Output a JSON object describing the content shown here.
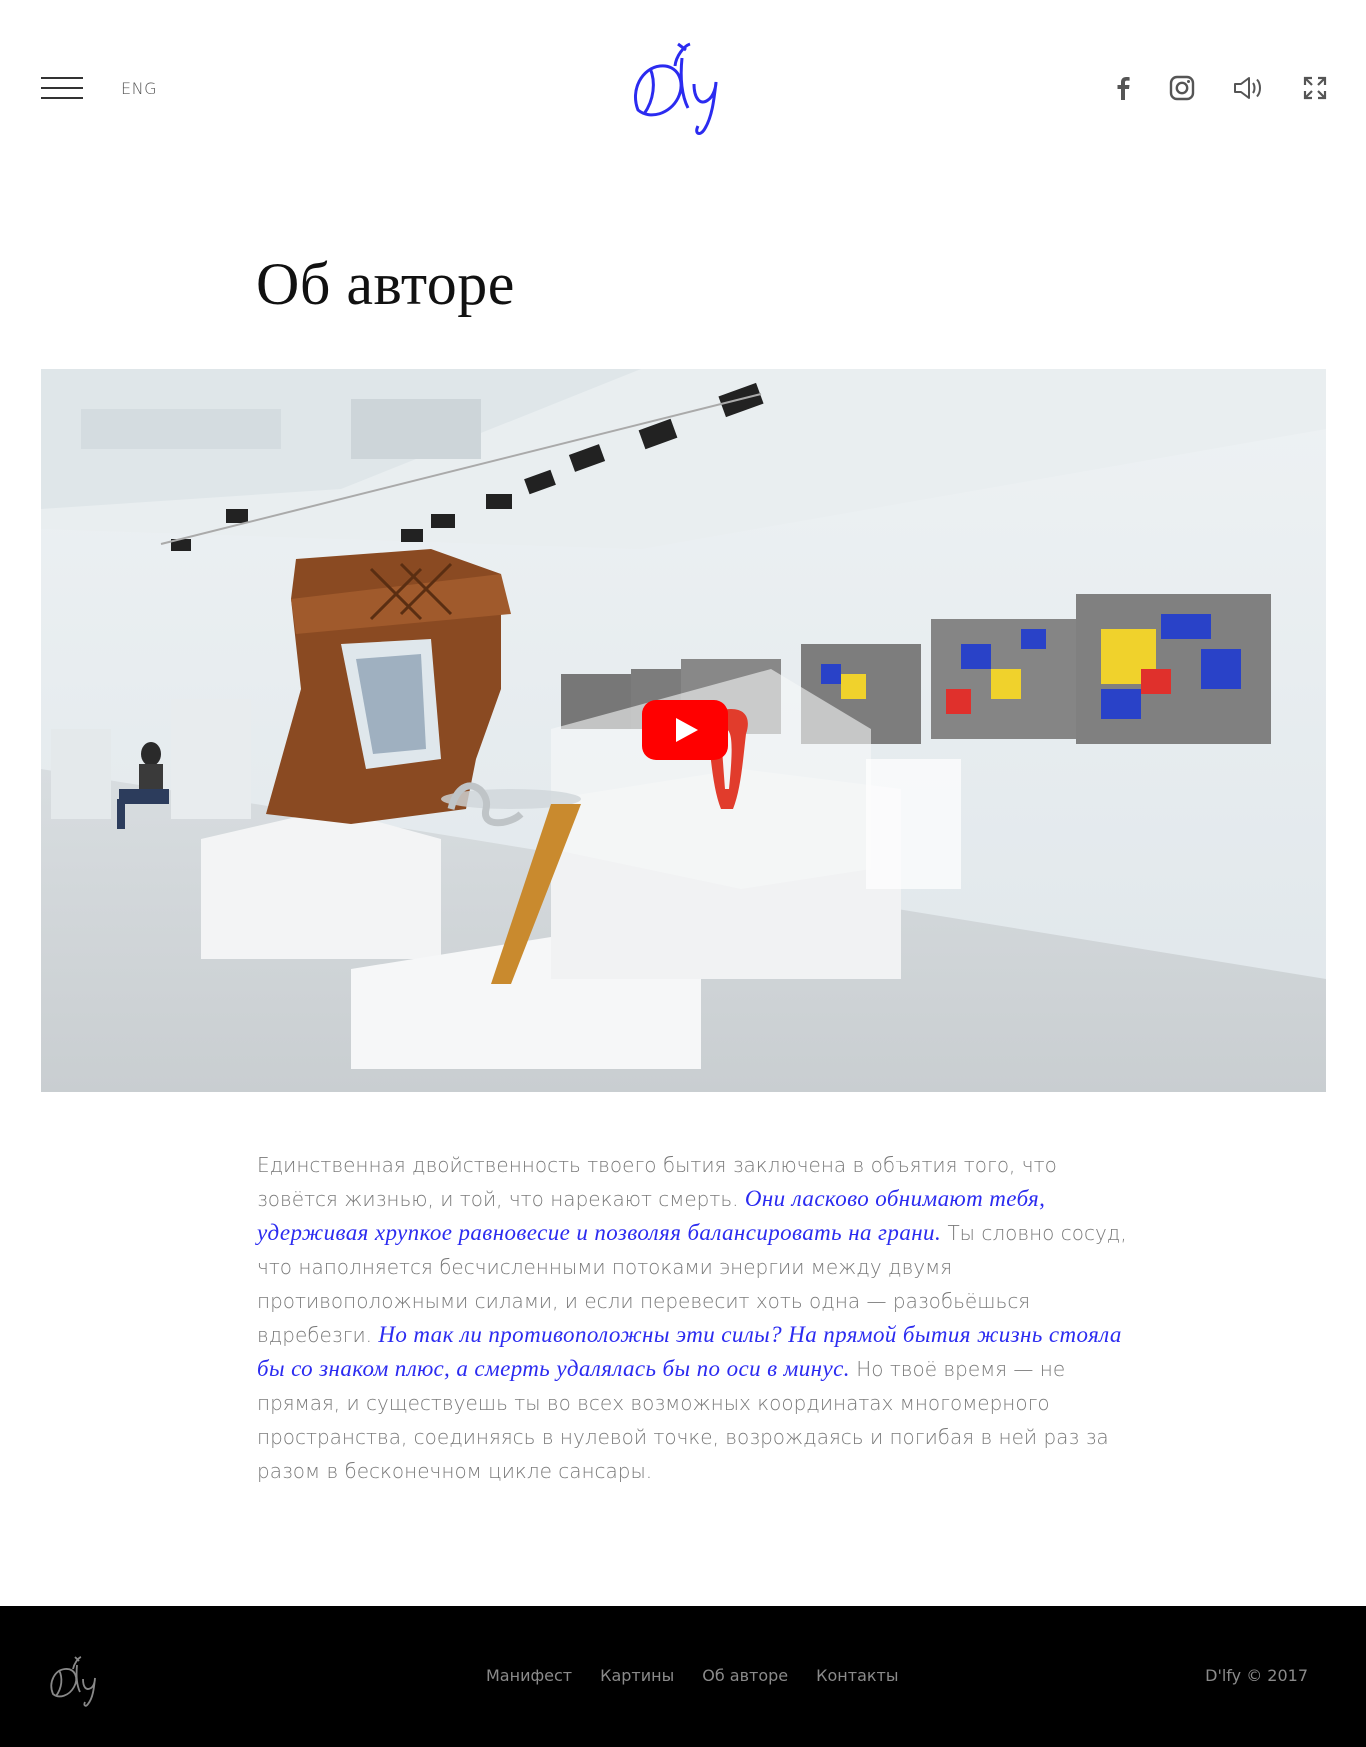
{
  "header": {
    "lang": "ENG",
    "logo_text": "D'lfy",
    "social": [
      "facebook-icon",
      "instagram-icon",
      "sound-icon",
      "fullscreen-icon"
    ]
  },
  "title": "Об авторе",
  "video": {
    "play_icon": "youtube-play-icon"
  },
  "body": {
    "p1": "Единственная двойственность твоего бытия заключена в объятия того, что зовётся жизнью, и той, что нарекают смерть. ",
    "a1": "Они ласково обнимают тебя, удерживая хрупкое равновесие и позволяя балансировать на грани.",
    "p2": " Ты словно сосуд, что наполняется бесчисленными потоками энергии между двумя противоположными силами, и если перевесит хоть одна — разобьёшься вдребезги. ",
    "a2": "Но так ли противоположны эти силы? На прямой бытия жизнь стояла бы со знаком плюс, а смерть удалялась бы по оси в минус.",
    "p3": " Но твоё время — не прямая, и существуешь ты во всех возможных координатах многомерного пространства, соединяясь в нулевой точке, возрождаясь и погибая в ней раз за разом в бесконечном цикле сансары."
  },
  "footer": {
    "logo_text": "D'lfy",
    "nav": [
      "Манифест",
      "Картины",
      "Об авторе",
      "Контакты"
    ],
    "copyright": "D'lfy © 2017"
  },
  "colors": {
    "accent": "#2b2bf0",
    "text": "#7a7a7a",
    "footer_bg": "#000000",
    "play": "#ff0000"
  }
}
